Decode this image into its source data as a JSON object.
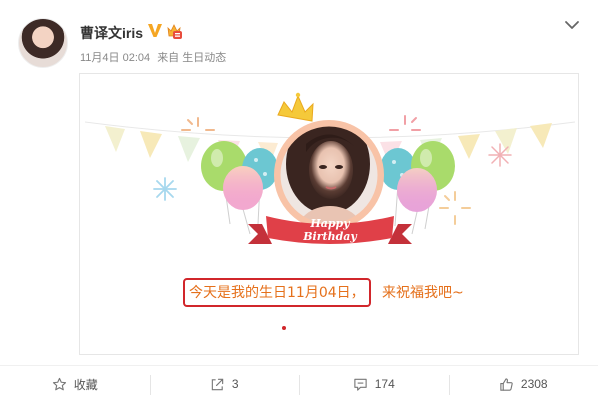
{
  "user": {
    "name": "曹译文iris",
    "date": "11月4日 02:04",
    "source": "来自 生日动态"
  },
  "card": {
    "banner_label": "Happy Birthday",
    "greeting_highlight": "今天是我的生日11月04日，",
    "greeting_rest": "来祝福我吧~"
  },
  "actions": {
    "favorite": "收藏",
    "repost": "3",
    "comment": "174",
    "like": "2308"
  },
  "colors": {
    "verified": "#f5a623",
    "greeting_text": "#e5701b",
    "highlight_border": "#d1262b",
    "ribbon": "#e04048"
  },
  "icons": {
    "verified": "verified-v-icon",
    "member": "member-badge-icon",
    "menu": "chevron-down-icon",
    "favorite": "star-icon",
    "repost": "share-icon",
    "comment": "comment-icon",
    "like": "thumbs-up-icon"
  }
}
